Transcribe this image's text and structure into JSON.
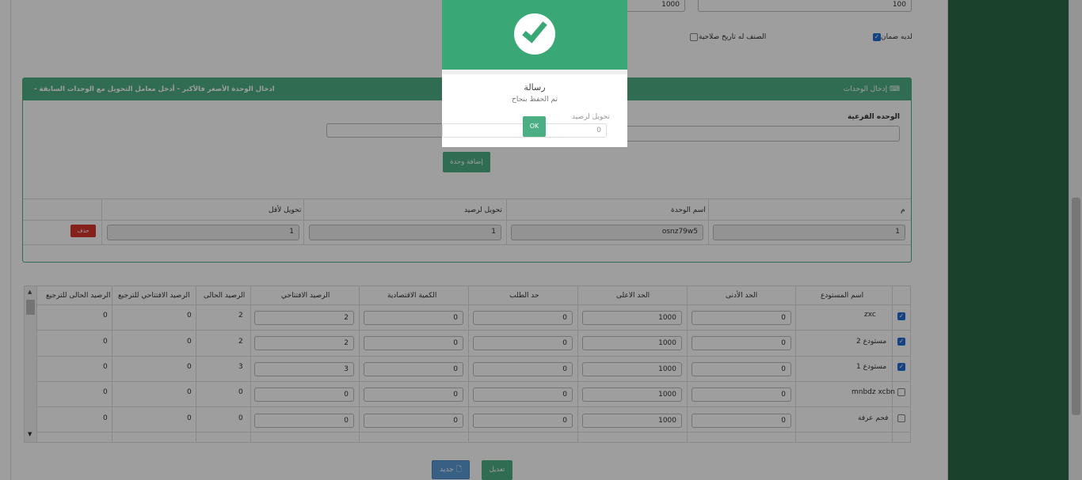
{
  "top_fields": {
    "max_value": "1000",
    "min_value": "100"
  },
  "options": {
    "has_warranty_label": "لديه ضمان",
    "has_warranty_checked": true,
    "has_expiry_label": "الصنف له تاريخ صلاحية",
    "has_expiry_checked": false
  },
  "units_panel": {
    "title": "إدخال الوحدات",
    "hint": "- ادخال الوحدة الأصغر فالأكبر - أدخل معامل التحويل مع الوحدات السابقة",
    "sub_unit_label": "الوحده الفرعية",
    "conversion_label": "تحويل لرصيد",
    "conversion_value": "0",
    "add_unit_button": "إضافة وحدة",
    "table_headers": {
      "index": "م",
      "unit_name": "اسم الوحدة",
      "to_balance": "تحويل لرصيد",
      "to_smaller": "تحويل لأقل"
    },
    "rows": [
      {
        "index": "1",
        "unit_name": "osnz79w5",
        "to_balance": "1",
        "to_smaller": "1",
        "delete_label": "حذف"
      }
    ]
  },
  "warehouses": {
    "headers": {
      "name": "اسم المستودع",
      "min": "الحد الأدنى",
      "max": "الحد الاعلى",
      "reorder": "حد الطلب",
      "economic_qty": "الكمية الاقتصادية",
      "opening_balance": "الرصيد الافتتاحي",
      "current_balance": "الرصيد الحالى",
      "opening_balance_return": "الرصيد الافتتاحي للترجيع",
      "current_balance_return": "الرصيد الحالى للترجيع"
    },
    "rows": [
      {
        "checked": true,
        "name": "zxc",
        "min": "0",
        "max": "1000",
        "reorder": "0",
        "economic_qty": "0",
        "opening_balance": "2",
        "current_balance": "2",
        "opening_balance_return": "0",
        "current_balance_return": "0"
      },
      {
        "checked": true,
        "name": "مستودع 2",
        "min": "0",
        "max": "1000",
        "reorder": "0",
        "economic_qty": "0",
        "opening_balance": "2",
        "current_balance": "2",
        "opening_balance_return": "0",
        "current_balance_return": "0"
      },
      {
        "checked": true,
        "name": "مستودع 1",
        "min": "0",
        "max": "1000",
        "reorder": "0",
        "economic_qty": "0",
        "opening_balance": "3",
        "current_balance": "3",
        "opening_balance_return": "0",
        "current_balance_return": "0"
      },
      {
        "checked": false,
        "name": "mnbdz xcbn",
        "min": "0",
        "max": "1000",
        "reorder": "0",
        "economic_qty": "0",
        "opening_balance": "0",
        "current_balance": "0",
        "opening_balance_return": "0",
        "current_balance_return": "0"
      },
      {
        "checked": false,
        "name": "فحم عرفة",
        "min": "0",
        "max": "1000",
        "reorder": "0",
        "economic_qty": "0",
        "opening_balance": "0",
        "current_balance": "0",
        "opening_balance_return": "0",
        "current_balance_return": "0"
      }
    ]
  },
  "footer_buttons": {
    "edit": "تعديل",
    "new": "جديد"
  },
  "modal": {
    "title": "رسالة",
    "message": "تم الحفظ بنجاح",
    "ok": "OK"
  },
  "colors": {
    "accent": "#4caf83",
    "danger": "#d9342b",
    "rail": "#2a6a47",
    "modal_top": "#3aa876"
  }
}
